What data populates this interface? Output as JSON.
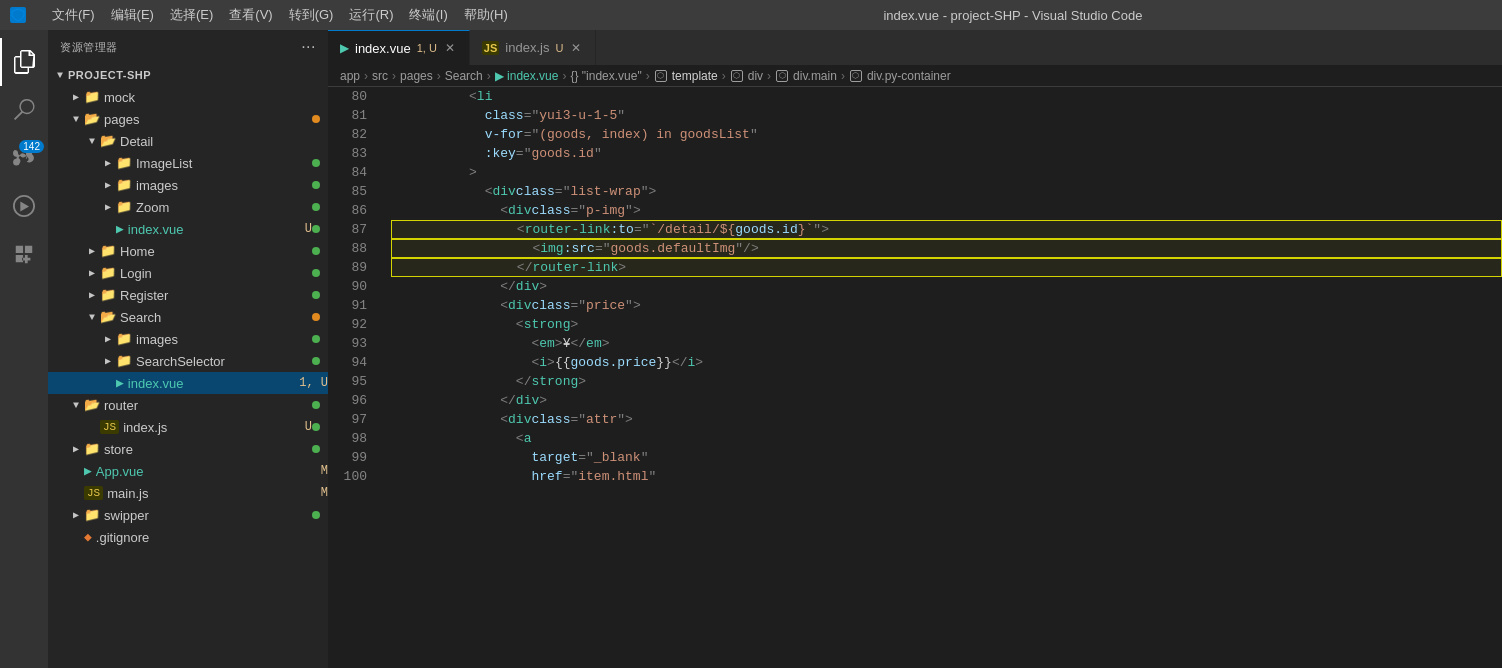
{
  "titleBar": {
    "menus": [
      "文件(F)",
      "编辑(E)",
      "选择(E)",
      "查看(V)",
      "转到(G)",
      "运行(R)",
      "终端(I)",
      "帮助(H)"
    ],
    "title": "index.vue - project-SHP - Visual Studio Code"
  },
  "sidebar": {
    "header": "资源管理器",
    "dotsLabel": "···",
    "rootLabel": "PROJECT-SHP",
    "items": [
      {
        "label": "mock",
        "type": "folder",
        "indent": 1,
        "collapsed": true,
        "dot": "none"
      },
      {
        "label": "pages",
        "type": "folder",
        "indent": 1,
        "collapsed": false,
        "dot": "orange"
      },
      {
        "label": "Detail",
        "type": "folder",
        "indent": 2,
        "collapsed": false,
        "dot": "none"
      },
      {
        "label": "ImageList",
        "type": "folder",
        "indent": 3,
        "collapsed": true,
        "dot": "green"
      },
      {
        "label": "images",
        "type": "folder",
        "indent": 3,
        "collapsed": true,
        "dot": "green"
      },
      {
        "label": "Zoom",
        "type": "folder",
        "indent": 3,
        "collapsed": true,
        "dot": "green"
      },
      {
        "label": "index.vue",
        "type": "vue",
        "indent": 3,
        "badge": "U",
        "dot": "green"
      },
      {
        "label": "Home",
        "type": "folder",
        "indent": 2,
        "collapsed": true,
        "dot": "green"
      },
      {
        "label": "Login",
        "type": "folder",
        "indent": 2,
        "collapsed": true,
        "dot": "green"
      },
      {
        "label": "Register",
        "type": "folder",
        "indent": 2,
        "collapsed": true,
        "dot": "green"
      },
      {
        "label": "Search",
        "type": "folder",
        "indent": 2,
        "collapsed": false,
        "dot": "orange"
      },
      {
        "label": "images",
        "type": "folder",
        "indent": 3,
        "collapsed": true,
        "dot": "green"
      },
      {
        "label": "SearchSelector",
        "type": "folder",
        "indent": 3,
        "collapsed": true,
        "dot": "green"
      },
      {
        "label": "index.vue",
        "type": "vue",
        "indent": 3,
        "badge": "1, U",
        "dot": "orange",
        "active": true
      },
      {
        "label": "router",
        "type": "folder",
        "indent": 1,
        "collapsed": false,
        "dot": "green"
      },
      {
        "label": "index.js",
        "type": "js",
        "indent": 2,
        "badge": "U",
        "dot": "green"
      },
      {
        "label": "store",
        "type": "folder",
        "indent": 1,
        "collapsed": true,
        "dot": "green"
      },
      {
        "label": "App.vue",
        "type": "vue",
        "indent": 1,
        "badge": "M",
        "dot": "none"
      },
      {
        "label": "main.js",
        "type": "js",
        "indent": 1,
        "badge": "M",
        "dot": "none"
      },
      {
        "label": "swipper",
        "type": "folder",
        "indent": 1,
        "collapsed": true,
        "dot": "green"
      },
      {
        "label": ".gitignore",
        "type": "git",
        "indent": 1,
        "dot": "none"
      }
    ]
  },
  "tabs": [
    {
      "label": "index.vue",
      "type": "vue",
      "modified": "1, U",
      "active": true
    },
    {
      "label": "index.js",
      "type": "js",
      "modified": "U",
      "active": false
    }
  ],
  "breadcrumb": {
    "parts": [
      "app",
      "src",
      "pages",
      "Search",
      "index.vue",
      "{} \"index.vue\"",
      "template",
      "div",
      "div.main",
      "div.py-container"
    ]
  },
  "codeLines": [
    {
      "num": 80,
      "content": "          <li"
    },
    {
      "num": 81,
      "content": "            class=\"yui3-u-1-5\""
    },
    {
      "num": 82,
      "content": "            v-for=\"(goods, index) in goodsList\""
    },
    {
      "num": 83,
      "content": "            :key=\"goods.id\""
    },
    {
      "num": 84,
      "content": "          >"
    },
    {
      "num": 85,
      "content": "            <div class=\"list-wrap\">"
    },
    {
      "num": 86,
      "content": "              <div class=\"p-img\">"
    },
    {
      "num": 87,
      "content": "                <router-link :to=\"`/detail/${goods.id}`\">",
      "highlighted": true
    },
    {
      "num": 88,
      "content": "                  <img :src=\"goods.defaultImg\"/>",
      "highlighted": true
    },
    {
      "num": 89,
      "content": "                </router-link>",
      "highlighted": true
    },
    {
      "num": 90,
      "content": "              </div>"
    },
    {
      "num": 91,
      "content": "              <div class=\"price\">"
    },
    {
      "num": 92,
      "content": "                <strong>"
    },
    {
      "num": 93,
      "content": "                  <em>¥</em>"
    },
    {
      "num": 94,
      "content": "                  <i>{{ goods.price }}</i>"
    },
    {
      "num": 95,
      "content": "                </strong>"
    },
    {
      "num": 96,
      "content": "              </div>"
    },
    {
      "num": 97,
      "content": "              <div class=\"attr\">"
    },
    {
      "num": 98,
      "content": "                <a"
    },
    {
      "num": 99,
      "content": "                  target=\"_blank\""
    },
    {
      "num": 100,
      "content": "                  href=\"item.html\""
    }
  ],
  "colors": {
    "background": "#1e1e1e",
    "sidebar": "#252526",
    "tabBar": "#2d2d2d",
    "activeTab": "#1e1e1e",
    "accent": "#007acc",
    "highlight": "#d4d400"
  }
}
